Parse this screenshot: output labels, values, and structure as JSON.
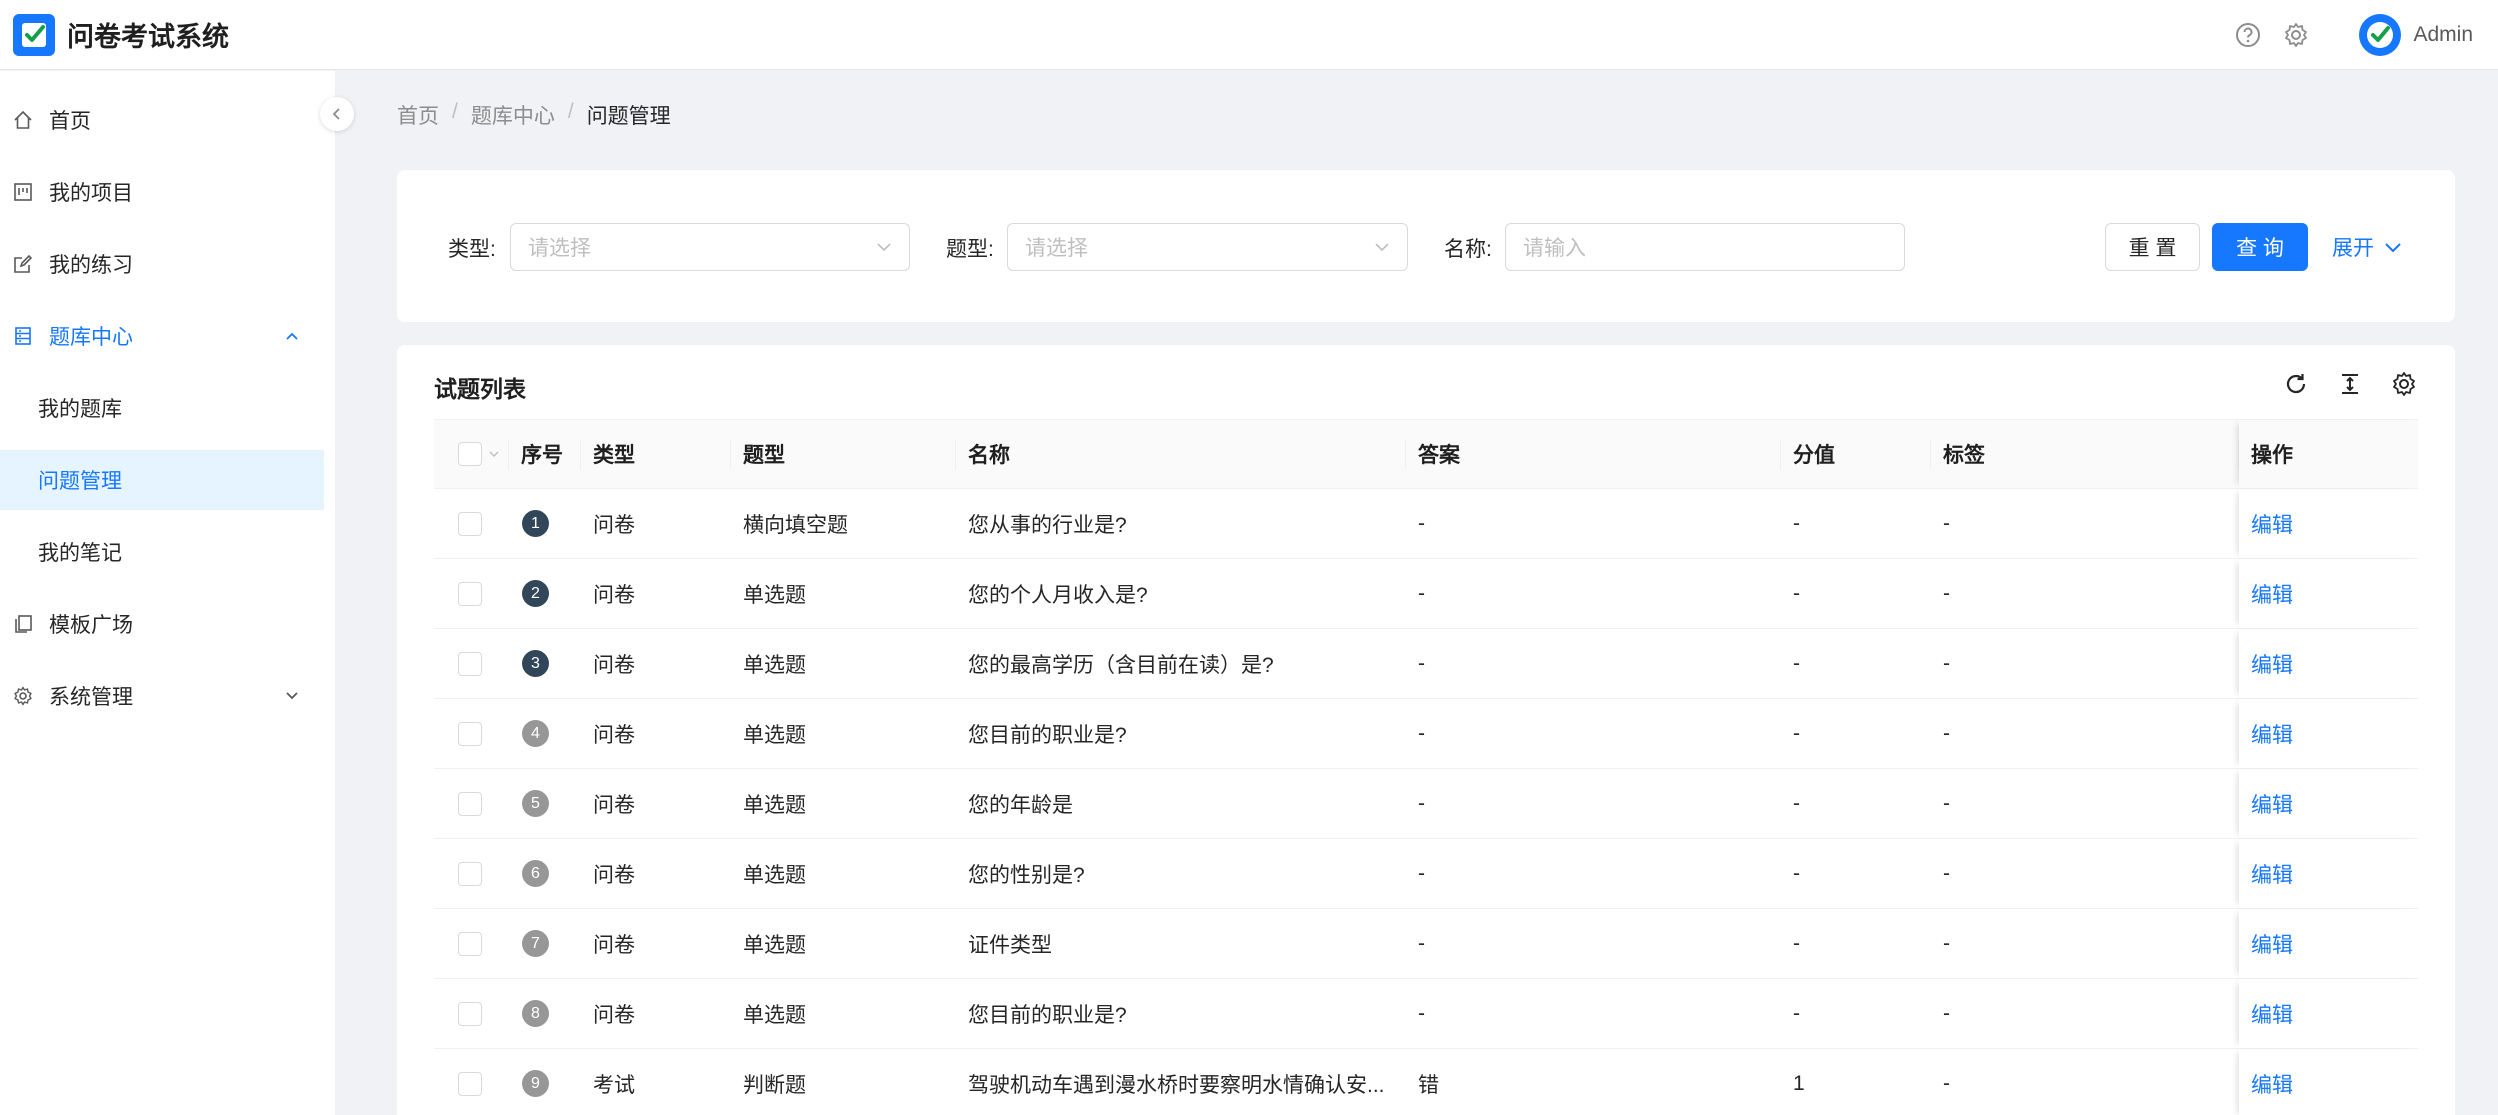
{
  "app": {
    "title": "问卷考试系统",
    "username": "Admin"
  },
  "sidebar": {
    "items": [
      {
        "label": "首页",
        "icon": "home-icon"
      },
      {
        "label": "我的项目",
        "icon": "project-icon"
      },
      {
        "label": "我的练习",
        "icon": "edit-icon"
      },
      {
        "label": "题库中心",
        "icon": "database-icon",
        "open": true
      },
      {
        "label": "模板广场",
        "icon": "copy-icon"
      },
      {
        "label": "系统管理",
        "icon": "setting-icon"
      }
    ],
    "sub_items": [
      {
        "label": "我的题库"
      },
      {
        "label": "问题管理",
        "active": true
      },
      {
        "label": "我的笔记"
      }
    ]
  },
  "breadcrumb": {
    "items": [
      "首页",
      "题库中心",
      "问题管理"
    ],
    "separator": "/"
  },
  "filter": {
    "type_label": "类型:",
    "type_placeholder": "请选择",
    "qtype_label": "题型:",
    "qtype_placeholder": "请选择",
    "name_label": "名称:",
    "name_placeholder": "请输入",
    "reset_label": "重 置",
    "query_label": "查 询",
    "expand_label": "展开"
  },
  "table": {
    "title": "试题列表",
    "columns": [
      "序号",
      "类型",
      "题型",
      "名称",
      "答案",
      "分值",
      "标签",
      "操作"
    ],
    "rows": [
      {
        "idx": "1",
        "type": "问卷",
        "qtype": "横向填空题",
        "name": "您从事的行业是?",
        "answer": "-",
        "score": "-",
        "tag": "-",
        "op": "编辑"
      },
      {
        "idx": "2",
        "type": "问卷",
        "qtype": "单选题",
        "name": "您的个人月收入是?",
        "answer": "-",
        "score": "-",
        "tag": "-",
        "op": "编辑"
      },
      {
        "idx": "3",
        "type": "问卷",
        "qtype": "单选题",
        "name": "您的最高学历（含目前在读）是?",
        "answer": "-",
        "score": "-",
        "tag": "-",
        "op": "编辑"
      },
      {
        "idx": "4",
        "type": "问卷",
        "qtype": "单选题",
        "name": "您目前的职业是?",
        "answer": "-",
        "score": "-",
        "tag": "-",
        "op": "编辑"
      },
      {
        "idx": "5",
        "type": "问卷",
        "qtype": "单选题",
        "name": "您的年龄是",
        "answer": "-",
        "score": "-",
        "tag": "-",
        "op": "编辑"
      },
      {
        "idx": "6",
        "type": "问卷",
        "qtype": "单选题",
        "name": "您的性别是?",
        "answer": "-",
        "score": "-",
        "tag": "-",
        "op": "编辑"
      },
      {
        "idx": "7",
        "type": "问卷",
        "qtype": "单选题",
        "name": "证件类型",
        "answer": "-",
        "score": "-",
        "tag": "-",
        "op": "编辑"
      },
      {
        "idx": "8",
        "type": "问卷",
        "qtype": "单选题",
        "name": "您目前的职业是?",
        "answer": "-",
        "score": "-",
        "tag": "-",
        "op": "编辑"
      },
      {
        "idx": "9",
        "type": "考试",
        "qtype": "判断题",
        "name": "驾驶机动车遇到漫水桥时要察明水情确认安...",
        "answer": "错",
        "score": "1",
        "tag": "-",
        "op": "编辑"
      }
    ]
  },
  "colors": {
    "primary": "#1677ff",
    "badge_dark": "#314659",
    "badge_gray": "#979797"
  }
}
